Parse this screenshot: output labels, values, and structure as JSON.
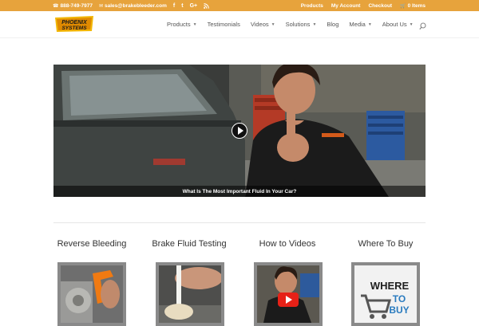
{
  "topbar": {
    "phone": "888-749-7977",
    "email": "sales@brakebleeder.com",
    "social": [
      "f",
      "t",
      "G+",
      "rss"
    ],
    "links": [
      "Products",
      "My Account",
      "Checkout"
    ],
    "cart": "0 Items"
  },
  "header": {
    "logo_text": "PHOENIX SYSTEMS",
    "nav": [
      {
        "label": "Products",
        "dropdown": true
      },
      {
        "label": "Testimonials",
        "dropdown": false
      },
      {
        "label": "Videos",
        "dropdown": true
      },
      {
        "label": "Solutions",
        "dropdown": true
      },
      {
        "label": "Blog",
        "dropdown": false
      },
      {
        "label": "Media",
        "dropdown": true
      },
      {
        "label": "About Us",
        "dropdown": true
      }
    ]
  },
  "video": {
    "caption": "What Is The Most Important Fluid In Your Car?"
  },
  "features": [
    {
      "title": "Reverse Bleeding"
    },
    {
      "title": "Brake Fluid Testing"
    },
    {
      "title": "How to Videos"
    },
    {
      "title": "Where To Buy"
    }
  ],
  "where_to_buy_image": {
    "line1": "WHERE",
    "line2": "TO",
    "line3": "BUY"
  },
  "colors": {
    "topbar": "#e7a33c",
    "accent": "#2ea3f2"
  }
}
